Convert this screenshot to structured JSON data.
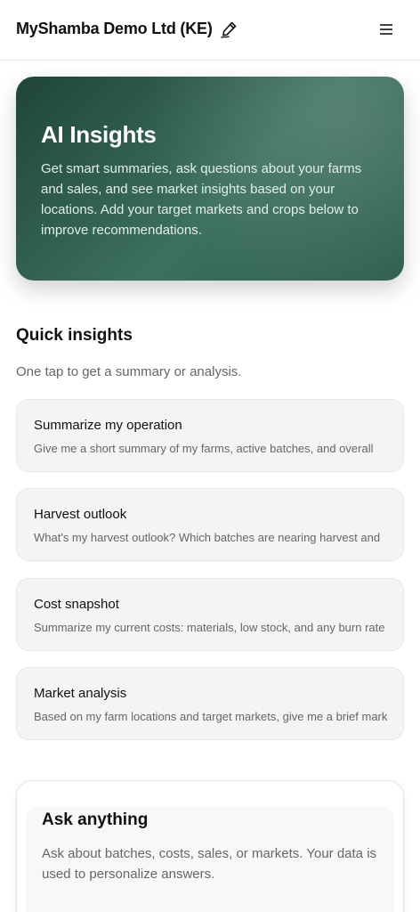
{
  "header": {
    "org_name": "MyShamba Demo Ltd (KE)",
    "edit_icon": "edit-pen-icon",
    "menu_icon": "hamburger-menu-icon"
  },
  "hero": {
    "title": "AI Insights",
    "description": "Get smart summaries, ask questions about your farms and sales, and see market insights based on your locations. Add your target markets and crops below to improve recommendations."
  },
  "quick_insights": {
    "title": "Quick insights",
    "subtitle": "One tap to get a summary or analysis.",
    "items": [
      {
        "title": "Summarize my operation",
        "description": "Give me a short summary of my farms, active batches, and overall"
      },
      {
        "title": "Harvest outlook",
        "description": "What's my harvest outlook? Which batches are nearing harvest and"
      },
      {
        "title": "Cost snapshot",
        "description": "Summarize my current costs: materials, low stock, and any burn rate"
      },
      {
        "title": "Market analysis",
        "description": "Based on my farm locations and target markets, give me a brief market"
      }
    ]
  },
  "ask": {
    "title": "Ask anything",
    "description": "Ask about batches, costs, sales, or markets. Your data is used to personalize answers."
  },
  "colors": {
    "hero_gradient_start": "#1f4538",
    "hero_gradient_end": "#3c7060",
    "card_background": "#f4f4f4"
  }
}
